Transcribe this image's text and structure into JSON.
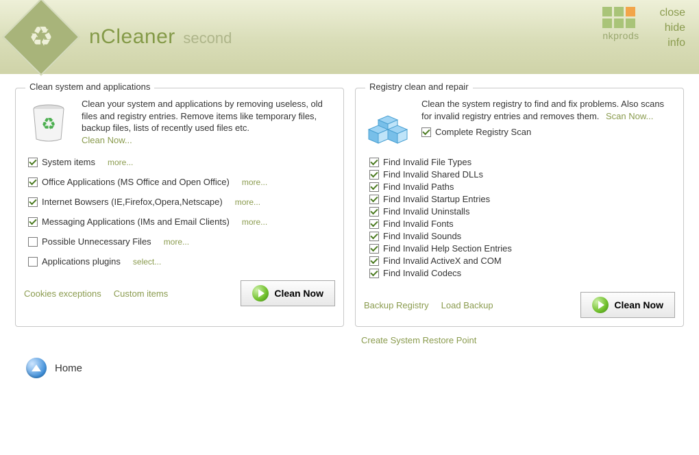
{
  "app": {
    "title": "nCleaner",
    "subtitle": "second",
    "home_label": "Home"
  },
  "window_links": {
    "close": "close",
    "hide": "hide",
    "info": "info"
  },
  "brand": {
    "name": "nkprods"
  },
  "left": {
    "title": "Clean system and applications",
    "desc": "Clean your system and applications by removing useless, old files and registry entries. Remove items like temporary files, backup files, lists of recently used files etc.",
    "clean_link": "Clean Now...",
    "items": [
      {
        "label": "System items",
        "more": "more...",
        "checked": true
      },
      {
        "label": "Office Applications (MS Office and Open Office)",
        "more": "more...",
        "checked": true
      },
      {
        "label": "Internet Bowsers (IE,Firefox,Opera,Netscape)",
        "more": "more...",
        "checked": true
      },
      {
        "label": "Messaging Applications (IMs and Email Clients)",
        "more": "more...",
        "checked": true
      },
      {
        "label": "Possible Unnecessary Files",
        "more": "more...",
        "checked": false
      },
      {
        "label": "Applications plugins",
        "more": "select...",
        "checked": false
      }
    ],
    "footer": {
      "cookies": "Cookies exceptions",
      "custom": "Custom items",
      "button": "Clean Now"
    }
  },
  "right": {
    "title": "Registry clean and repair",
    "desc": "Clean the system registry to find and fix problems. Also scans for invalid registry entries and removes them.",
    "scan_link": "Scan Now...",
    "complete_label": "Complete Registry Scan",
    "options": [
      "Find Invalid File Types",
      "Find Invalid Shared DLLs",
      "Find Invalid Paths",
      "Find Invalid Startup Entries",
      "Find Invalid Uninstalls",
      "Find Invalid Fonts",
      "Find Invalid Sounds",
      "Find Invalid Help Section Entries",
      "Find Invalid ActiveX and COM",
      "Find Invalid Codecs"
    ],
    "footer": {
      "backup": "Backup Registry",
      "load": "Load Backup",
      "button": "Clean Now"
    },
    "restore": "Create System Restore Point"
  }
}
